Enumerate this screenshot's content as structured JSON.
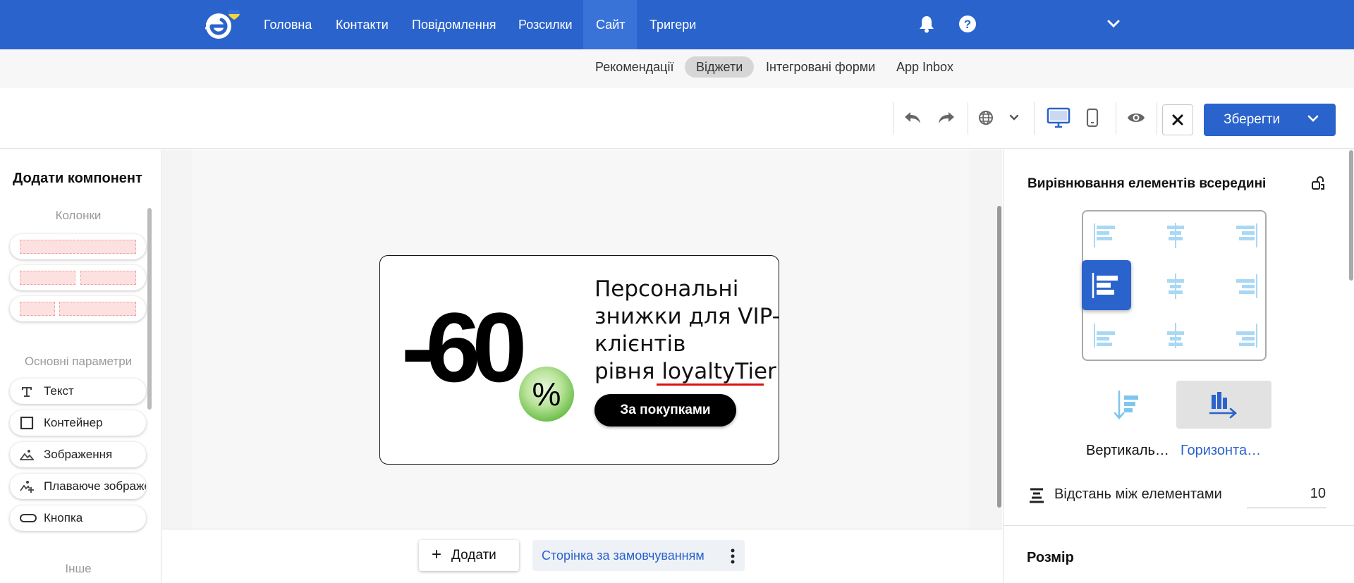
{
  "topnav": {
    "items": [
      {
        "label": "Головна"
      },
      {
        "label": "Контакти"
      },
      {
        "label": "Повідомлення"
      },
      {
        "label": "Розсилки"
      },
      {
        "label": "Сайт"
      },
      {
        "label": "Тригери"
      }
    ],
    "active_item": "Сайт",
    "icons": [
      "bell-icon",
      "help-icon",
      "chevron-down-icon"
    ]
  },
  "subnav": {
    "items": [
      {
        "label": "Рекомендації"
      },
      {
        "label": "Віджети"
      },
      {
        "label": "Інтегровані форми"
      },
      {
        "label": "App Inbox"
      }
    ],
    "active_item": "Віджети"
  },
  "toolbar": {
    "icons": [
      "undo-icon",
      "redo-icon",
      "globe-icon",
      "chevron-down-icon",
      "desktop-icon",
      "mobile-icon",
      "eye-icon",
      "close-icon"
    ],
    "active_view": "desktop",
    "save_label": "Зберегти"
  },
  "left_panel": {
    "title": "Додати компонент",
    "columns_section": "Колонки",
    "basic_section": "Основні параметри",
    "components": [
      {
        "label": "Текст",
        "icon": "text-icon"
      },
      {
        "label": "Контейнер",
        "icon": "container-icon"
      },
      {
        "label": "Зображення",
        "icon": "image-icon"
      },
      {
        "label": "Плаваюче зображення",
        "icon": "floating-image-icon"
      },
      {
        "label": "Кнопка",
        "icon": "button-icon"
      }
    ],
    "other_section": "Інше"
  },
  "widget": {
    "discount": "-60",
    "percent": "%",
    "text_lines": [
      "Персональні",
      "знижки для VIP-",
      "клієнтів"
    ],
    "text_line4_prefix": "рівня ",
    "text_line4_var": "loyaltyTier",
    "button_label": "За покупками"
  },
  "bottom_bar": {
    "add_label": "Додати",
    "page_label": "Сторінка за замовчуванням"
  },
  "right_panel": {
    "alignment_title": "Вирівнювання елементів всередині",
    "selected_alignment": "middle-left",
    "directions": [
      {
        "label": "Вертикаль…",
        "icon": "vertical-direction-icon"
      },
      {
        "label": "Горизонта…",
        "icon": "horizontal-direction-icon"
      }
    ],
    "selected_direction": "horizontal",
    "gap_label": "Відстань між елементами",
    "gap_value": "10",
    "size_title": "Розмір"
  },
  "colors": {
    "brand_blue": "#2a63cc",
    "nav_active": "#3a73d8",
    "light_icon": "#a9d8f5",
    "highlight_green": "#5fb83d",
    "underline_red": "#dd1111"
  }
}
